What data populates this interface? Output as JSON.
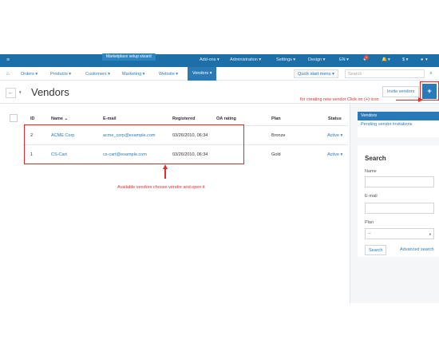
{
  "topbar": {
    "logo_icon": "home-dashboard-icon",
    "wizard_label": "Marketplace setup wizard",
    "addons": "Add-ons ▾",
    "administration": "Administration ▾",
    "settings": "Settings ▾",
    "design": "Design ▾",
    "language": "EN ▾",
    "notification_count": "1",
    "user": "▾",
    "currency": "$ ▾",
    "account": "▾"
  },
  "nav": {
    "home_icon": "home-icon",
    "orders": "Orders ▾",
    "products": "Products ▾",
    "customers": "Customers ▾",
    "marketing": "Marketing ▾",
    "website": "Website ▾",
    "vendors": "Vendors ▾",
    "quick_start": "Quick start menu ▾",
    "search_placeholder": "Search"
  },
  "page": {
    "title": "Vendors",
    "invite_label": "Invite vendors",
    "add_label": "+"
  },
  "annotations": {
    "create_hint": "for creating new vendor Click on (+) icon",
    "open_hint": "Available vendors choose vendor and open it"
  },
  "table": {
    "headers": {
      "id": "ID",
      "name": "Name ⌄",
      "email": "E-mail",
      "registered": "Registered",
      "oa": "OA rating",
      "plan": "Plan",
      "status": "Status"
    },
    "rows": [
      {
        "id": "2",
        "name": "ACME Corp",
        "email": "acme_corp@example.com",
        "registered": "03/26/2010, 06:34",
        "plan": "Bronze",
        "status": "Active ▾"
      },
      {
        "id": "1",
        "name": "CS-Cart",
        "email": "cs-cart@example.com",
        "registered": "03/26/2010, 06:34",
        "plan": "Gold",
        "status": "Active ▾"
      }
    ]
  },
  "sidebar": {
    "links": [
      "Vendors",
      "Pending vendor invitations"
    ],
    "search_title": "Search",
    "name_label": "Name",
    "email_label": "E-mail",
    "plan_label": "Plan",
    "plan_value": "--",
    "search_button": "Search",
    "advanced_link": "Advanced search"
  },
  "colors": {
    "brand": "#1d6fa8",
    "accent": "#2a7ab8",
    "annotation": "#e32c2c"
  }
}
